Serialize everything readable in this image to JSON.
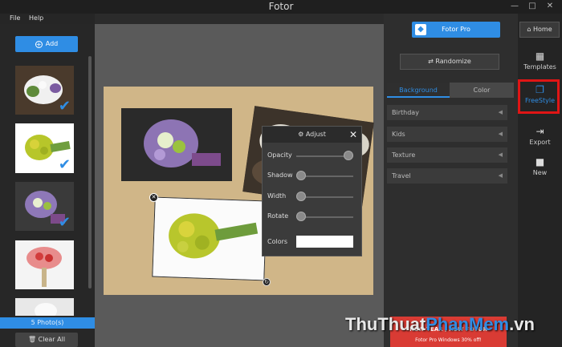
{
  "window": {
    "title": "Fotor",
    "minimize_icon": "minimize-icon",
    "maximize_icon": "maximize-icon",
    "close_icon": "close-icon"
  },
  "menu": {
    "file": "File",
    "help": "Help"
  },
  "left_panel": {
    "add_label": "Add",
    "photos_count": "5 Photo(s)",
    "clear_label": "Clear All",
    "thumbnails": [
      {
        "checked": true
      },
      {
        "checked": true
      },
      {
        "checked": true
      },
      {
        "checked": false
      },
      {
        "checked": false
      }
    ]
  },
  "adjust": {
    "title": "Adjust",
    "opacity_label": "Opacity",
    "opacity_value": 1.0,
    "shadow_label": "Shadow",
    "shadow_value": 0.0,
    "width_label": "Width",
    "width_value": 0.0,
    "rotate_label": "Rotate",
    "rotate_value": 0.0,
    "colors_label": "Colors",
    "color_value": "#ffffff"
  },
  "right_panel": {
    "pro_label": "Fotor Pro",
    "randomize_label": "Randomize",
    "tabs": [
      {
        "label": "Background"
      },
      {
        "label": "Color"
      }
    ],
    "items": [
      {
        "label": "Birthday"
      },
      {
        "label": "Kids"
      },
      {
        "label": "Texture"
      },
      {
        "label": "Travel"
      }
    ],
    "promo_line1": "NEW YEAR , NEW FOTOR",
    "promo_line2": "Fotor Pro Windows 30% off!"
  },
  "toolbar": {
    "home": "Home",
    "templates": "Templates",
    "freestyle": "FreeStyle",
    "export": "Export",
    "new": "New"
  },
  "watermark": {
    "part1": "ThuThuat",
    "part2": "PhanMem",
    "part3": ".vn"
  },
  "colors": {
    "accent": "#2f8de4",
    "highlight": "#e01515",
    "canvas_bg": "#d0b688"
  }
}
